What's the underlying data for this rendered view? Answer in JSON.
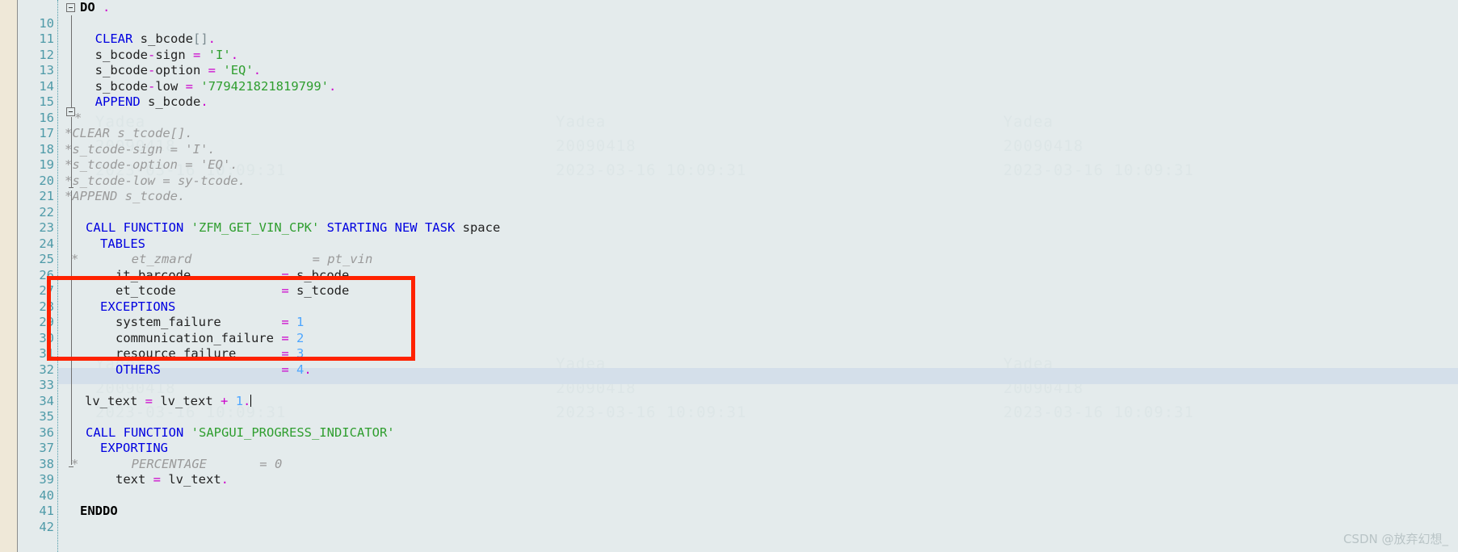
{
  "editor": {
    "name": "abap-code-editor",
    "background_color": "#E4EBEC",
    "margin_color": "#EFE8D8",
    "line_number_color": "#4E9AA8",
    "first_line": 10,
    "last_line": 42,
    "current_line": 35,
    "current_line_highlight_color": "#D4DFEA"
  },
  "lines": [
    {
      "n": "10",
      "text": "DO ."
    },
    {
      "n": "11",
      "text": ""
    },
    {
      "n": "12",
      "text": "    CLEAR s_bcode[]."
    },
    {
      "n": "13",
      "text": "    s_bcode-sign = 'I'."
    },
    {
      "n": "14",
      "text": "    s_bcode-option = 'EQ'."
    },
    {
      "n": "15",
      "text": "    s_bcode-low = '779421821819799'."
    },
    {
      "n": "16",
      "text": "    APPEND s_bcode."
    },
    {
      "n": "17",
      "text": "*"
    },
    {
      "n": "18",
      "text": "*CLEAR s_tcode[]."
    },
    {
      "n": "19",
      "text": "*s_tcode-sign = 'I'."
    },
    {
      "n": "20",
      "text": "*s_tcode-option = 'EQ'."
    },
    {
      "n": "21",
      "text": "*s_tcode-low = sy-tcode."
    },
    {
      "n": "22",
      "text": "*APPEND s_tcode."
    },
    {
      "n": "23",
      "text": ""
    },
    {
      "n": "24",
      "text": "    CALL FUNCTION 'ZFM_GET_VIN_CPK' STARTING NEW TASK space"
    },
    {
      "n": "25",
      "text": "      TABLES"
    },
    {
      "n": "26",
      "text": "*       et_zmard                = pt_vin"
    },
    {
      "n": "27",
      "text": "        it_barcode              = s_bcode"
    },
    {
      "n": "28",
      "text": "        et_tcode                = s_tcode"
    },
    {
      "n": "29",
      "text": "      EXCEPTIONS"
    },
    {
      "n": "30",
      "text": "        system_failure          = 1"
    },
    {
      "n": "31",
      "text": "        communication_failure = 2"
    },
    {
      "n": "32",
      "text": "        resource_failure        = 3"
    },
    {
      "n": "33",
      "text": "        OTHERS                  = 4."
    },
    {
      "n": "34",
      "text": ""
    },
    {
      "n": "35",
      "text": "  lv_text = lv_text + 1."
    },
    {
      "n": "36",
      "text": ""
    },
    {
      "n": "37",
      "text": "    CALL FUNCTION 'SAPGUI_PROGRESS_INDICATOR'"
    },
    {
      "n": "38",
      "text": "      EXPORTING"
    },
    {
      "n": "39",
      "text": "*       PERCENTAGE       = 0"
    },
    {
      "n": "40",
      "text": "        text = lv_text."
    },
    {
      "n": "41",
      "text": ""
    },
    {
      "n": "42",
      "text": "ENDDO"
    }
  ],
  "annotation": {
    "name": "red-highlight-rectangle",
    "color": "#FF2200",
    "covers_lines": "29-34",
    "label": ""
  },
  "watermark": {
    "company": "Yadea",
    "user_id": "20090418",
    "timestamp": "2023-03-16 10:09:31"
  },
  "credit": {
    "text": "CSDN @放弃幻想_"
  }
}
